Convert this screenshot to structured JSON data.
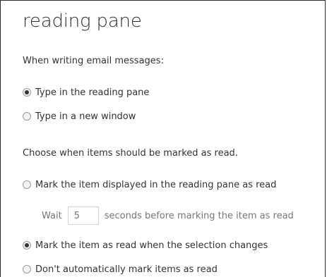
{
  "pane": {
    "title": "reading pane",
    "writing_section_label": "When writing email messages:",
    "writing_options": [
      {
        "label": "Type in the reading pane",
        "checked": true
      },
      {
        "label": "Type in a new window",
        "checked": false
      }
    ],
    "read_section_label": "Choose when items should be marked as read.",
    "read_options": [
      {
        "label": "Mark the item displayed in the reading pane as read",
        "checked": false
      },
      {
        "label": "Mark the item as read when the selection changes",
        "checked": true
      },
      {
        "label": "Don't automatically mark items as read",
        "checked": false
      }
    ],
    "wait": {
      "prefix": "Wait",
      "value": "5",
      "suffix": "seconds before marking the item as read"
    }
  },
  "colors": {
    "text": "#333333",
    "muted_text": "#777777",
    "border": "#2b2b2b"
  }
}
